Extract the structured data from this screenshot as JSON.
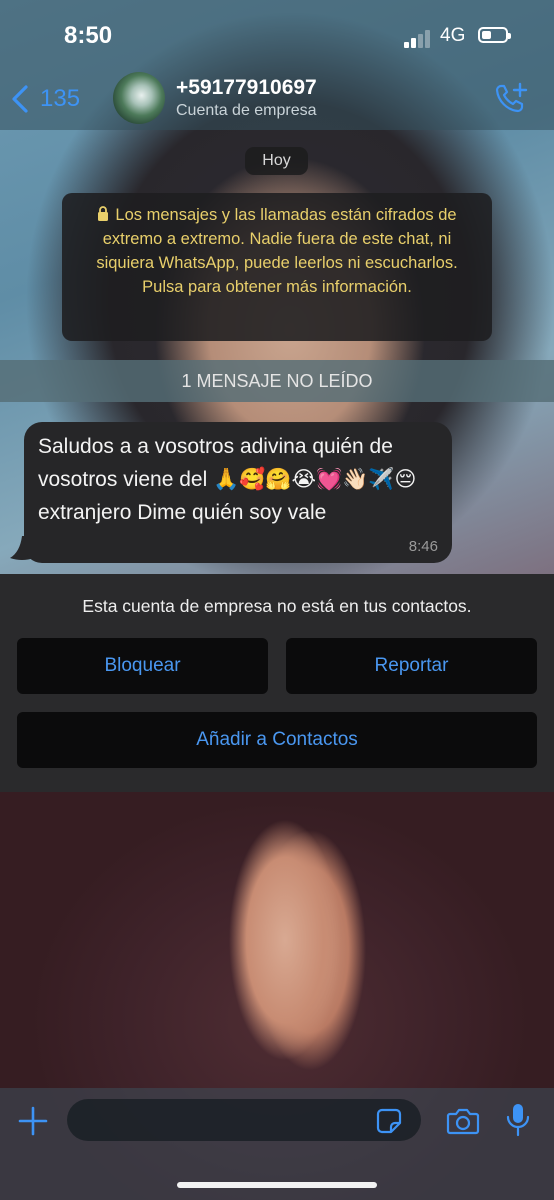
{
  "status_bar": {
    "time": "8:50",
    "network": "4G",
    "signal_bars": 2,
    "signal_bars_total": 4,
    "battery_level": 0.3
  },
  "header": {
    "back_count": "135",
    "contact_name": "+59177910697",
    "contact_subtitle": "Cuenta de empresa",
    "back_icon": "chevron-left-icon",
    "call_icon": "phone-add-icon"
  },
  "chat": {
    "date_label": "Hoy",
    "encryption_notice": "Los mensajes y las llamadas están cifrados de extremo a extremo. Nadie fuera de este chat, ni siquiera WhatsApp, puede leerlos ni escucharlos. Pulsa para obtener más información.",
    "unread_banner": "1 MENSAJE NO LEÍDO",
    "messages": [
      {
        "text": "Saludos a a vosotros adivina quién de vosotros viene del 🙏🥰🤗😭💓👋🏻✈️😔extranjero Dime quién soy vale",
        "time": "8:46",
        "direction": "incoming"
      }
    ]
  },
  "business_panel": {
    "notice": "Esta cuenta de empresa no está en tus contactos.",
    "block_label": "Bloquear",
    "report_label": "Reportar",
    "add_contact_label": "Añadir a Contactos"
  },
  "input_bar": {
    "placeholder": "",
    "icons": [
      "plus-icon",
      "sticker-icon",
      "camera-icon",
      "microphone-icon"
    ]
  },
  "colors": {
    "accent": "#3d93f5",
    "encryption_text": "#e8cf6b",
    "bubble_bg": "#262628",
    "panel_bg": "#2a2a2c",
    "button_bg": "#0b0b0c"
  }
}
